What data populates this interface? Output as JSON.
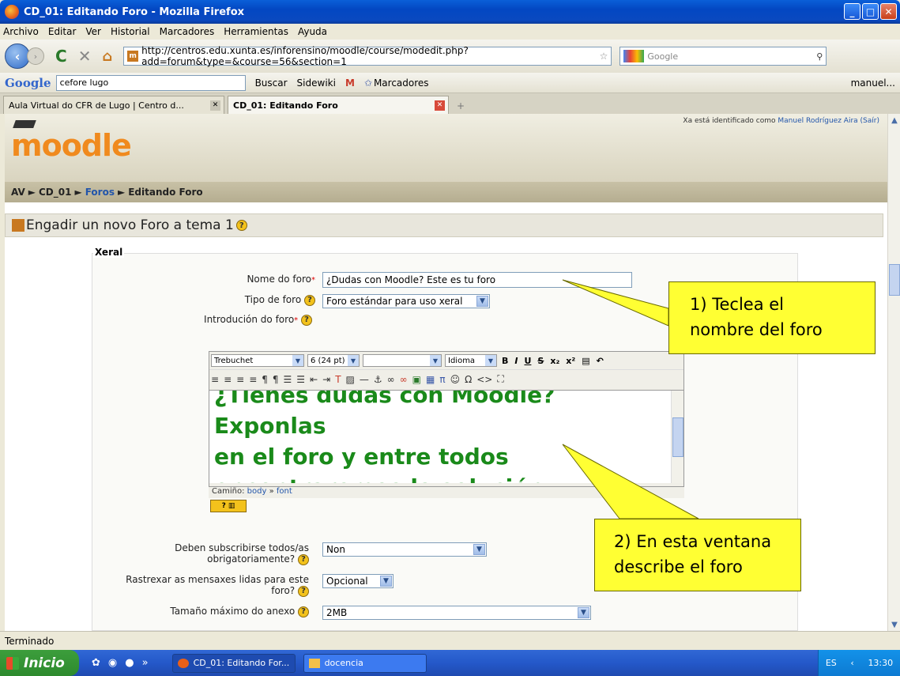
{
  "window": {
    "title": "CD_01: Editando Foro - Mozilla Firefox"
  },
  "menu": [
    "Archivo",
    "Editar",
    "Ver",
    "Historial",
    "Marcadores",
    "Herramientas",
    "Ayuda"
  ],
  "nav": {
    "url": "http://centros.edu.xunta.es/inforensino/moodle/course/modedit.php?add=forum&type=&course=56&section=1",
    "search_placeholder": "Google"
  },
  "google_toolbar": {
    "brand": "Google",
    "query": "cefore lugo",
    "buscar": "Buscar",
    "sidewiki": "Sidewiki",
    "marcadores": "Marcadores",
    "user": "manuel..."
  },
  "tabs": [
    {
      "label": "Aula Virtual do CFR de Lugo | Centro d...",
      "active": false
    },
    {
      "label": "CD_01: Editando Foro",
      "active": true
    }
  ],
  "page": {
    "logo": "moodle",
    "logged_in_prefix": "Xa está identificado como",
    "logged_in_user": "Manuel Rodríguez Aira",
    "logout": "(Saír)",
    "breadcrumb": {
      "av": "AV",
      "course": "CD_01",
      "foros": "Foros",
      "current": "Editando Foro"
    },
    "heading": "Engadir un novo Foro a tema 1",
    "fieldset_legend": "Xeral",
    "fields": {
      "name_label": "Nome do foro",
      "name_value": "¿Dudas con Moodle? Este es tu foro",
      "type_label": "Tipo de foro",
      "type_value": "Foro estándar para uso xeral",
      "intro_label": "Introdución do foro",
      "subscribe_label_1": "Deben subscribirse todos/as",
      "subscribe_label_2": "obrigatoriamente?",
      "subscribe_value": "Non",
      "track_label_1": "Rastrexar as mensaxes lidas para este",
      "track_label_2": "foro?",
      "track_value": "Opcional",
      "maxsize_label": "Tamaño máximo do anexo",
      "maxsize_value": "2MB"
    },
    "editor": {
      "font": "Trebuchet",
      "size": "6 (24 pt)",
      "format": "",
      "lang": "Idioma",
      "content_line1": "¿Tienes dudas con Moodle? Exponlas",
      "content_line2": "en el foro y entre todos",
      "content_line3": "encontraremos la solución.",
      "path_label": "Camiño:",
      "path_body": "body",
      "path_sep": "»",
      "path_font": "font"
    }
  },
  "callouts": {
    "c1_line1": "1) Teclea el",
    "c1_line2": "nombre del foro",
    "c2_line1": "2) En esta ventana",
    "c2_line2": "describe el foro"
  },
  "status": "Terminado",
  "taskbar": {
    "start": "Inicio",
    "tasks": [
      "CD_01: Editando For...",
      "docencia"
    ],
    "lang": "ES",
    "time": "13:30"
  }
}
